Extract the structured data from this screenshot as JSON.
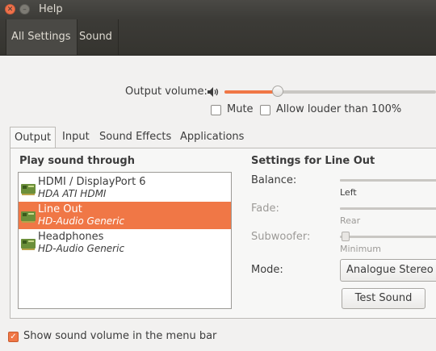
{
  "window": {
    "menu_help": "Help"
  },
  "toolbar": {
    "all_settings": "All Settings",
    "sound": "Sound"
  },
  "output_volume": {
    "label": "Output volume:",
    "level": 0.25,
    "mute_label": "Mute",
    "mute_checked": false,
    "louder_label": "Allow louder than 100%",
    "louder_checked": false
  },
  "tabs": [
    {
      "label": "Output",
      "active": true
    },
    {
      "label": "Input",
      "active": false
    },
    {
      "label": "Sound Effects",
      "active": false
    },
    {
      "label": "Applications",
      "active": false
    }
  ],
  "output": {
    "play_through_title": "Play sound through",
    "devices": [
      {
        "name": "HDMI / DisplayPort 6",
        "subtitle": "HDA ATI HDMI",
        "selected": false
      },
      {
        "name": "Line Out",
        "subtitle": "HD-Audio Generic",
        "selected": true
      },
      {
        "name": "Headphones",
        "subtitle": "HD-Audio Generic",
        "selected": false
      }
    ],
    "settings_title": "Settings for Line Out",
    "balance_label": "Balance:",
    "balance_caption": "Left",
    "fade_label": "Fade:",
    "fade_caption": "Rear",
    "subwoofer_label": "Subwoofer:",
    "subwoofer_caption": "Minimum",
    "mode_label": "Mode:",
    "mode_value": "Analogue Stereo O",
    "test_sound": "Test Sound"
  },
  "menu_bar_option": {
    "label": "Show sound volume in the menu bar",
    "checked": true
  },
  "colors": {
    "accent": "#f07746",
    "titlebar": "#3c3b37"
  },
  "icons": {
    "close": "close-icon",
    "minimize": "minimize-icon",
    "speaker": "speaker-icon",
    "device": "audio-card-icon"
  }
}
